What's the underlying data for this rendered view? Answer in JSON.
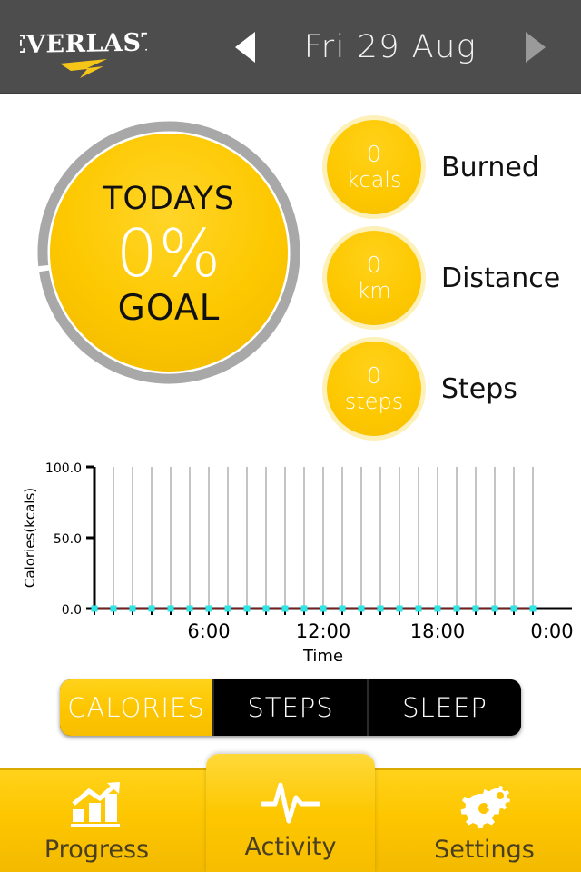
{
  "header": {
    "brand": "EVERLAST",
    "prev_icon": "triangle-left-icon",
    "next_icon": "triangle-right-icon",
    "date": "Fri 29 Aug",
    "bg_color": "#4d4d4d",
    "brand_accent": "#f5c518"
  },
  "goal": {
    "top_label": "TODAYS",
    "percent": "0%",
    "bottom_label": "GOAL",
    "progress_value": 0,
    "fill_color": "#fdc800",
    "ring_color": "#a8a8a8"
  },
  "stats": [
    {
      "value": "0",
      "unit": "kcals",
      "label": "Burned"
    },
    {
      "value": "0",
      "unit": "km",
      "label": "Distance"
    },
    {
      "value": "0",
      "unit": "steps",
      "label": "Steps"
    }
  ],
  "segmented": {
    "options": [
      "CALORIES",
      "STEPS",
      "SLEEP"
    ],
    "selected": "CALORIES",
    "active_color": "#fdc500",
    "inactive_color": "#000000"
  },
  "navigation": {
    "items": [
      {
        "label": "Progress",
        "icon": "bar-chart-arrow-icon",
        "active": false
      },
      {
        "label": "Activity",
        "icon": "heartbeat-pulse-icon",
        "active": true
      },
      {
        "label": "Settings",
        "icon": "gears-icon",
        "active": false
      }
    ],
    "bg_color": "#fdc600"
  },
  "chart_data": {
    "type": "line",
    "title": "",
    "xlabel": "Time",
    "ylabel": "Calories(kcals)",
    "ylim": [
      0,
      100
    ],
    "ytick_labels": [
      "0.0",
      "50.0",
      "100.0"
    ],
    "ytick_values": [
      0,
      50,
      100
    ],
    "xtick_labels": [
      "6:00",
      "12:00",
      "18:00",
      "0:00"
    ],
    "xtick_values": [
      6,
      12,
      18,
      24
    ],
    "xlim": [
      0,
      24
    ],
    "grid": "vertical",
    "legend": "none",
    "line_color": "#7a1f1f",
    "marker_color": "#2ee6e6",
    "x": [
      0,
      1,
      2,
      3,
      4,
      5,
      6,
      7,
      8,
      9,
      10,
      11,
      12,
      13,
      14,
      15,
      16,
      17,
      18,
      19,
      20,
      21,
      22,
      23
    ],
    "series": [
      {
        "name": "Calories",
        "values": [
          0,
          0,
          0,
          0,
          0,
          0,
          0,
          0,
          0,
          0,
          0,
          0,
          0,
          0,
          0,
          0,
          0,
          0,
          0,
          0,
          0,
          0,
          0,
          0
        ]
      }
    ]
  }
}
